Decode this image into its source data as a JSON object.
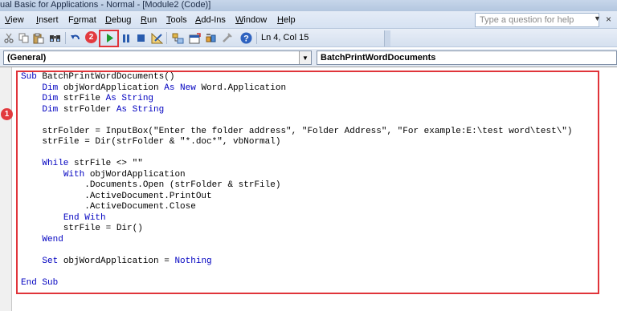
{
  "window": {
    "title": "ual Basic for Applications - Normal - [Module2 (Code)]"
  },
  "menu": {
    "items": [
      {
        "label": "View",
        "accel": "V",
        "rest": "iew"
      },
      {
        "label": "Insert",
        "accel": "I",
        "rest": "nsert"
      },
      {
        "label": "Format",
        "accel": "o",
        "pre": "F",
        "rest": "rmat"
      },
      {
        "label": "Debug",
        "accel": "D",
        "rest": "ebug"
      },
      {
        "label": "Run",
        "accel": "R",
        "rest": "un"
      },
      {
        "label": "Tools",
        "accel": "T",
        "rest": "ools"
      },
      {
        "label": "Add-Ins",
        "accel": "A",
        "rest": "dd-Ins"
      },
      {
        "label": "Window",
        "accel": "W",
        "rest": "indow"
      },
      {
        "label": "Help",
        "accel": "H",
        "rest": "elp"
      }
    ],
    "help_placeholder": "Type a question for help",
    "close_glyph": "×"
  },
  "toolbar": {
    "position": "Ln 4, Col 15",
    "icons": [
      "cut-icon",
      "copy-icon",
      "paste-icon",
      "find-icon",
      "undo-icon",
      "redo-icon",
      "run-icon",
      "break-icon",
      "reset-icon",
      "design-mode-icon",
      "project-explorer-icon",
      "properties-icon",
      "object-browser-icon",
      "toolbox-icon",
      "help-icon"
    ]
  },
  "annotations": {
    "badge1": "1",
    "badge2": "2"
  },
  "combos": {
    "object": "(General)",
    "procedure": "BatchPrintWordDocuments"
  },
  "code": {
    "lines": [
      [
        {
          "k": 1,
          "t": "Sub "
        },
        {
          "k": 0,
          "t": "BatchPrintWordDocuments()"
        }
      ],
      [
        {
          "k": 0,
          "t": "    "
        },
        {
          "k": 1,
          "t": "Dim "
        },
        {
          "k": 0,
          "t": "objWordApplication "
        },
        {
          "k": 1,
          "t": "As New "
        },
        {
          "k": 0,
          "t": "Word.Application"
        }
      ],
      [
        {
          "k": 0,
          "t": "    "
        },
        {
          "k": 1,
          "t": "Dim "
        },
        {
          "k": 0,
          "t": "strFile "
        },
        {
          "k": 1,
          "t": "As String"
        }
      ],
      [
        {
          "k": 0,
          "t": "    "
        },
        {
          "k": 1,
          "t": "Dim "
        },
        {
          "k": 0,
          "t": "strFolder "
        },
        {
          "k": 1,
          "t": "As String"
        }
      ],
      [],
      [
        {
          "k": 0,
          "t": "    strFolder = InputBox(\"Enter the folder address\", \"Folder Address\", \"For example:E:\\test word\\test\\\")"
        }
      ],
      [
        {
          "k": 0,
          "t": "    strFile = Dir(strFolder & \"*.doc*\", vbNormal)"
        }
      ],
      [],
      [
        {
          "k": 0,
          "t": "    "
        },
        {
          "k": 1,
          "t": "While "
        },
        {
          "k": 0,
          "t": "strFile <> \"\""
        }
      ],
      [
        {
          "k": 0,
          "t": "        "
        },
        {
          "k": 1,
          "t": "With "
        },
        {
          "k": 0,
          "t": "objWordApplication"
        }
      ],
      [
        {
          "k": 0,
          "t": "            .Documents.Open (strFolder & strFile)"
        }
      ],
      [
        {
          "k": 0,
          "t": "            .ActiveDocument.PrintOut"
        }
      ],
      [
        {
          "k": 0,
          "t": "            .ActiveDocument.Close"
        }
      ],
      [
        {
          "k": 0,
          "t": "        "
        },
        {
          "k": 1,
          "t": "End With"
        }
      ],
      [
        {
          "k": 0,
          "t": "        strFile = Dir()"
        }
      ],
      [
        {
          "k": 0,
          "t": "    "
        },
        {
          "k": 1,
          "t": "Wend"
        }
      ],
      [],
      [
        {
          "k": 0,
          "t": "    "
        },
        {
          "k": 1,
          "t": "Set "
        },
        {
          "k": 0,
          "t": "objWordApplication = "
        },
        {
          "k": 1,
          "t": "Nothing"
        }
      ],
      [],
      [
        {
          "k": 1,
          "t": "End Sub"
        }
      ]
    ]
  }
}
